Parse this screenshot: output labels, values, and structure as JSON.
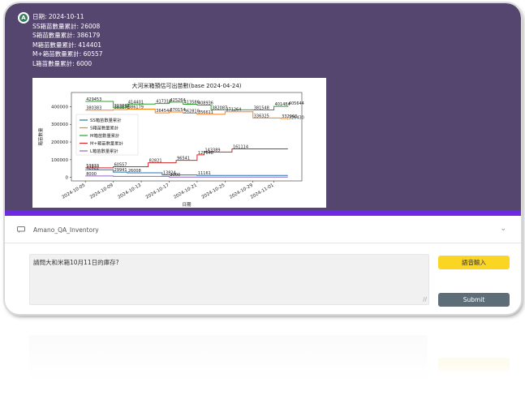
{
  "bot_message": {
    "lines": [
      "日期: 2024-10-11",
      "SS箱苗數量累計: 26008",
      "S箱苗數量累計: 386179",
      "M箱苗數量累計: 414401",
      "M+箱苗數量累計: 60557",
      "L箱苗數量累計: 6000"
    ]
  },
  "chart_data": {
    "type": "line",
    "title": "大河米箱預估可出苗數(base 2024-04-24)",
    "xlabel": "日期",
    "ylabel": "箱苗數量",
    "ylim": [
      -20000,
      480000
    ],
    "yticks": [
      0,
      100000,
      200000,
      300000,
      400000
    ],
    "ytick_labels": [
      "0",
      "100000",
      "200000",
      "300000",
      "400000"
    ],
    "xlim": [
      "2024-10-03",
      "2024-11-05"
    ],
    "xticks": [
      "2024-10-05",
      "2024-10-09",
      "2024-10-13",
      "2024-10-17",
      "2024-10-21",
      "2024-10-25",
      "2024-10-29",
      "2024-11-01"
    ],
    "legend_position": "center-left",
    "series": [
      {
        "name": "SS箱苗數量累計",
        "color": "#1f77b4",
        "points": [
          [
            "2024-10-05",
            42822
          ],
          [
            "2024-10-09",
            29941
          ],
          [
            "2024-10-11",
            26008
          ],
          [
            "2024-10-16",
            13824
          ],
          [
            "2024-10-21",
            11161
          ],
          [
            "2024-11-03",
            11161
          ]
        ]
      },
      {
        "name": "S箱苗數量累計",
        "color": "#ff7f0e",
        "points": [
          [
            "2024-10-05",
            380383
          ],
          [
            "2024-10-09",
            383178
          ],
          [
            "2024-10-11",
            386179
          ],
          [
            "2024-10-15",
            364544
          ],
          [
            "2024-10-17",
            370154
          ],
          [
            "2024-10-19",
            362810
          ],
          [
            "2024-10-21",
            356611
          ],
          [
            "2024-10-25",
            371264
          ],
          [
            "2024-10-29",
            336325
          ],
          [
            "2024-11-02",
            332960
          ],
          [
            "2024-11-03",
            326430
          ]
        ]
      },
      {
        "name": "M箱苗數量累計",
        "color": "#2ca02c",
        "points": [
          [
            "2024-10-05",
            429453
          ],
          [
            "2024-10-09",
            393867
          ],
          [
            "2024-10-11",
            414401
          ],
          [
            "2024-10-15",
            417316
          ],
          [
            "2024-10-17",
            425264
          ],
          [
            "2024-10-19",
            413586
          ],
          [
            "2024-10-21",
            408936
          ],
          [
            "2024-10-23",
            382087
          ],
          [
            "2024-10-29",
            381548
          ],
          [
            "2024-11-01",
            401484
          ],
          [
            "2024-11-03",
            405644
          ]
        ]
      },
      {
        "name": "M+箱苗數量累計",
        "color": "#d62728",
        "points": [
          [
            "2024-10-05",
            53833
          ],
          [
            "2024-10-09",
            60557
          ],
          [
            "2024-10-14",
            82821
          ],
          [
            "2024-10-18",
            96541
          ],
          [
            "2024-10-21",
            127648
          ],
          [
            "2024-10-22",
            143389
          ],
          [
            "2024-10-26",
            161114
          ],
          [
            "2024-11-03",
            161114
          ]
        ]
      },
      {
        "name": "L箱苗數量累計",
        "color": "#9467bd",
        "points": [
          [
            "2024-10-05",
            8000
          ],
          [
            "2024-10-09",
            6000
          ],
          [
            "2024-10-11",
            6000
          ],
          [
            "2024-10-17",
            2000
          ],
          [
            "2024-11-03",
            2000
          ]
        ]
      }
    ],
    "annotations": [
      {
        "x": "2024-10-05",
        "y": 429453,
        "text": "429453"
      },
      {
        "x": "2024-10-05",
        "y": 380383,
        "text": "380383"
      },
      {
        "x": "2024-10-09",
        "y": 393867,
        "text": "393867"
      },
      {
        "x": "2024-10-09",
        "y": 383178,
        "text": "383178"
      },
      {
        "x": "2024-10-11",
        "y": 414401,
        "text": "414401"
      },
      {
        "x": "2024-10-11",
        "y": 386179,
        "text": "386179"
      },
      {
        "x": "2024-10-15",
        "y": 417316,
        "text": "417316"
      },
      {
        "x": "2024-10-15",
        "y": 364544,
        "text": "364544"
      },
      {
        "x": "2024-10-17",
        "y": 425264,
        "text": "425264"
      },
      {
        "x": "2024-10-17",
        "y": 370154,
        "text": "370154"
      },
      {
        "x": "2024-10-19",
        "y": 413586,
        "text": "413586"
      },
      {
        "x": "2024-10-19",
        "y": 362810,
        "text": "362810"
      },
      {
        "x": "2024-10-21",
        "y": 408936,
        "text": "408936"
      },
      {
        "x": "2024-10-21",
        "y": 356611,
        "text": "356611"
      },
      {
        "x": "2024-10-23",
        "y": 382087,
        "text": "382087"
      },
      {
        "x": "2024-10-25",
        "y": 371264,
        "text": "371264"
      },
      {
        "x": "2024-10-29",
        "y": 381548,
        "text": "381548"
      },
      {
        "x": "2024-10-29",
        "y": 336325,
        "text": "336325"
      },
      {
        "x": "2024-11-01",
        "y": 401484,
        "text": "401484"
      },
      {
        "x": "2024-11-03",
        "y": 405644,
        "text": "405644"
      },
      {
        "x": "2024-11-02",
        "y": 332960,
        "text": "332960"
      },
      {
        "x": "2024-11-03",
        "y": 326430,
        "text": "326430"
      },
      {
        "x": "2024-10-05",
        "y": 53833,
        "text": "53833"
      },
      {
        "x": "2024-10-05",
        "y": 42822,
        "text": "42822"
      },
      {
        "x": "2024-10-05",
        "y": 8000,
        "text": "8000"
      },
      {
        "x": "2024-10-09",
        "y": 60557,
        "text": "60557"
      },
      {
        "x": "2024-10-09",
        "y": 29941,
        "text": "29941"
      },
      {
        "x": "2024-10-11",
        "y": 26008,
        "text": "26008"
      },
      {
        "x": "2024-10-14",
        "y": 82821,
        "text": "82821"
      },
      {
        "x": "2024-10-16",
        "y": 13824,
        "text": "13824"
      },
      {
        "x": "2024-10-17",
        "y": 2000,
        "text": "2000"
      },
      {
        "x": "2024-10-18",
        "y": 96541,
        "text": "96541"
      },
      {
        "x": "2024-10-21",
        "y": 127648,
        "text": "127648"
      },
      {
        "x": "2024-10-21",
        "y": 11161,
        "text": "11161"
      },
      {
        "x": "2024-10-22",
        "y": 143389,
        "text": "143389"
      },
      {
        "x": "2024-10-26",
        "y": 161114,
        "text": "161114"
      }
    ]
  },
  "accordion": {
    "title": "Amano_QA_Inventory",
    "chat_icon": "chat-bubble-icon",
    "toggle_icon": "chevron-down-icon"
  },
  "input": {
    "value": "請問大和米箱10月11日的庫存?"
  },
  "buttons": {
    "voice_label": "語音輸入",
    "submit_label": "Submit"
  },
  "colors": {
    "chat_background": "#55466f",
    "accent_bar": "#6e29e3",
    "voice_button": "#fad523",
    "submit_button": "#5e6e79"
  }
}
